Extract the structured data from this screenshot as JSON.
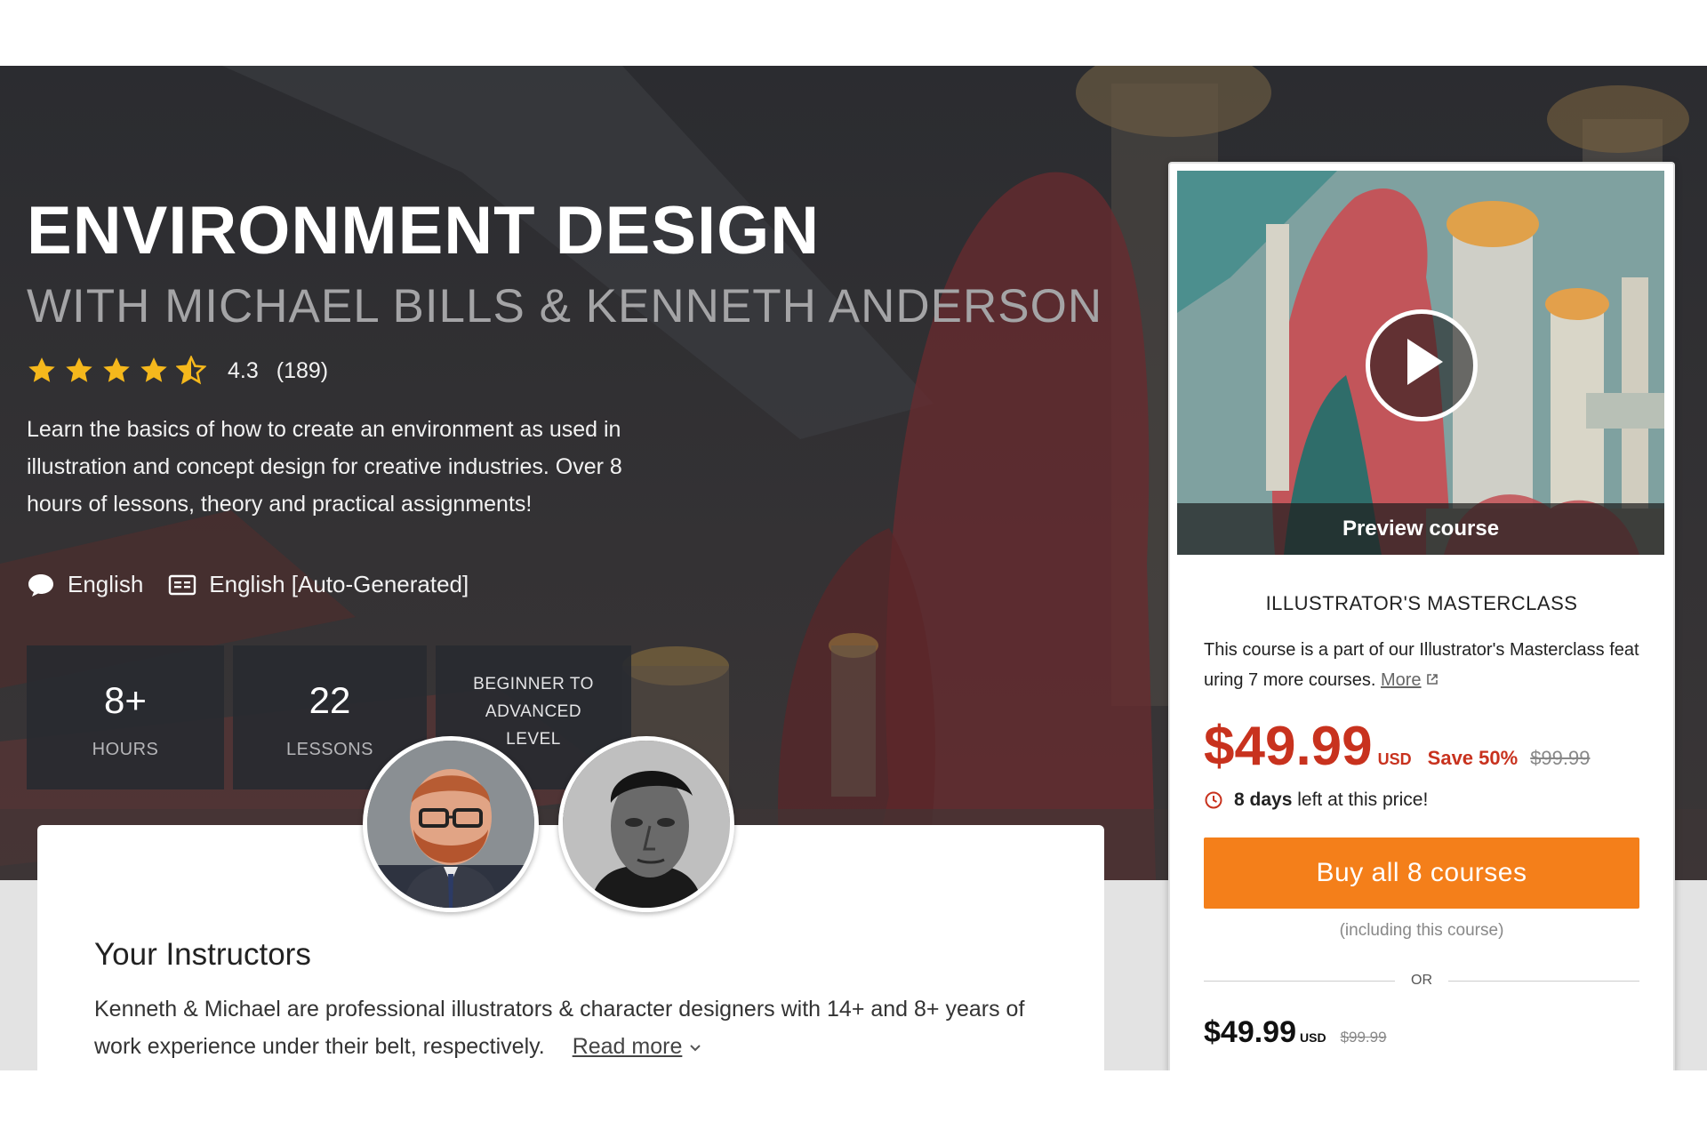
{
  "course": {
    "title": "ENVIRONMENT DESIGN",
    "subtitle": "WITH MICHAEL BILLS & KENNETH ANDERSON",
    "rating_value": 4.3,
    "rating_text": "4.3",
    "rating_count": "(189)",
    "description": "Learn the basics of how to create an environment as used in illustration and concept design for creative industries. Over 8 hours of lessons, theory and practical assignments!",
    "audio_language": "English",
    "subtitle_language": "English [Auto-Generated]",
    "icons": [
      "speech-bubble-icon",
      "closed-caption-icon",
      "star-icon",
      "clock-icon",
      "external-link-icon",
      "chevron-down-icon",
      "play-icon"
    ]
  },
  "stats": [
    {
      "value": "8+",
      "label": "HOURS"
    },
    {
      "value": "22",
      "label": "LESSONS"
    },
    {
      "line1": "BEGINNER TO",
      "line2": "ADVANCED",
      "line3": "LEVEL"
    }
  ],
  "instructors": {
    "title": "Your Instructors",
    "text": "Kenneth & Michael are professional illustrators & character designers with 14+ and 8+ years of work experience under their belt, respectively.",
    "read_more": "Read more"
  },
  "card": {
    "preview_label": "Preview course",
    "masterclass_title": "ILLUSTRATOR'S MASTERCLASS",
    "masterclass_text": "This course is a part of our Illustrator's Masterclass featuring 7 more courses.",
    "more_link": "More",
    "price": "$49.99",
    "currency": "USD",
    "save": "Save 50%",
    "old_price": "$99.99",
    "days_bold": "8 days",
    "days_rest": "left at this price!",
    "buy_label": "Buy all 8 courses",
    "including": "(including this course)",
    "or": "OR",
    "single_price": "$49.99",
    "single_currency": "USD",
    "single_old_price": "$99.99"
  },
  "colors": {
    "accent_orange": "#f47f1a",
    "price_red": "#c8321e",
    "star_yellow": "#f5b81c"
  }
}
